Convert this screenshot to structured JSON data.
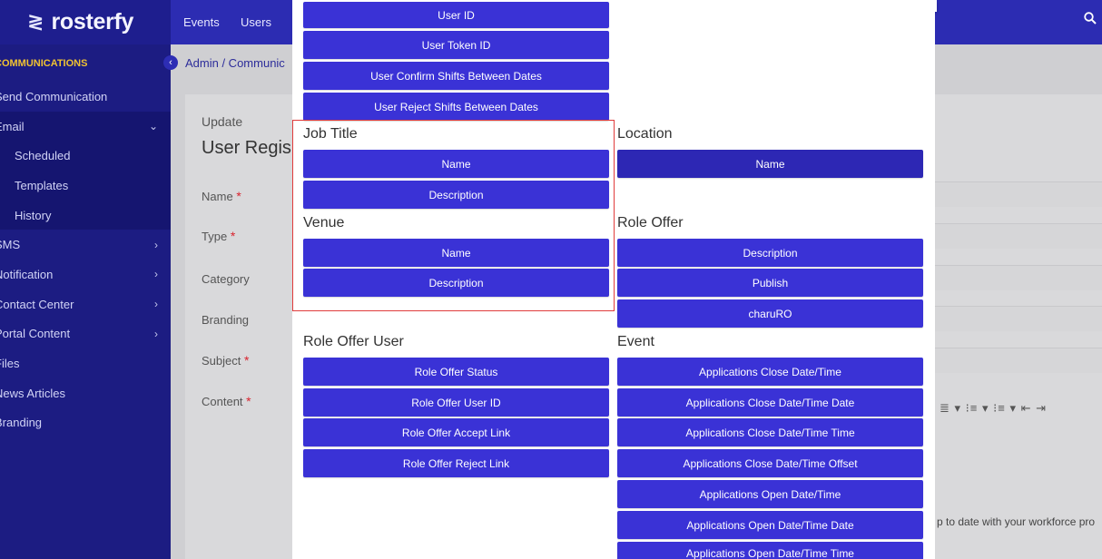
{
  "topbar": {
    "logo_text": "rosterfy",
    "nav": [
      "Events",
      "Users"
    ]
  },
  "sidebar": {
    "header": "COMMUNICATIONS",
    "items": [
      {
        "label": "Send Communication"
      },
      {
        "label": "Email",
        "chevron": "⌄"
      },
      {
        "label": "Scheduled"
      },
      {
        "label": "Templates"
      },
      {
        "label": "History"
      },
      {
        "label": "SMS",
        "chevron": "›"
      },
      {
        "label": "Notification",
        "chevron": "›"
      },
      {
        "label": "Contact Center",
        "chevron": "›"
      },
      {
        "label": "Portal Content",
        "chevron": "›"
      },
      {
        "label": "Files"
      },
      {
        "label": "News Articles"
      },
      {
        "label": "Branding"
      }
    ]
  },
  "breadcrumb": "Admin  /  Communic",
  "page": {
    "subtitle": "Update",
    "title": "User Regis",
    "labels": {
      "name": "Name",
      "type": "Type",
      "category": "Category",
      "branding": "Branding",
      "subject": "Subject",
      "content": "Content"
    },
    "required_mark": "*",
    "editor_tools": "≣ ▾   ⁝≡ ▾   ⁝≡ ▾   ⇤   ⇥",
    "partial_text": "p to date with your workforce pro"
  },
  "modal": {
    "user_fields": [
      "User ID",
      "User Token ID",
      "User Confirm Shifts Between Dates",
      "User Reject Shifts Between Dates"
    ],
    "job_title": {
      "title": "Job Title",
      "fields": [
        "Name",
        "Description"
      ]
    },
    "location": {
      "title": "Location",
      "fields": [
        "Name"
      ]
    },
    "venue": {
      "title": "Venue",
      "fields": [
        "Name",
        "Description"
      ]
    },
    "role_offer": {
      "title": "Role Offer",
      "fields": [
        "Description",
        "Publish",
        "charuRO"
      ]
    },
    "role_offer_user": {
      "title": "Role Offer User",
      "fields": [
        "Role Offer Status",
        "Role Offer User ID",
        "Role Offer Accept Link",
        "Role Offer Reject Link"
      ]
    },
    "event": {
      "title": "Event",
      "fields": [
        "Applications Close Date/Time",
        "Applications Close Date/Time Date",
        "Applications Close Date/Time Time",
        "Applications Close Date/Time Offset",
        "Applications Open Date/Time",
        "Applications Open Date/Time Date",
        "Applications Open Date/Time Time"
      ]
    }
  },
  "colors": {
    "brand_blue": "#2c2cb2",
    "button_blue": "#3a32d6",
    "sidebar_bg": "#1c1c82",
    "accent_yellow": "#f0c232",
    "highlight_red": "#e03b3b"
  },
  "icons": {
    "logo": "rosterfy-logo-icon",
    "search": "search-icon",
    "collapse": "collapse-arrow-icon"
  }
}
